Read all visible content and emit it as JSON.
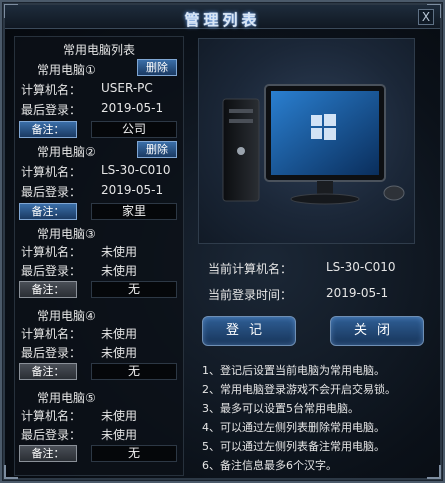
{
  "window": {
    "title": "管理列表",
    "close_label": "X"
  },
  "list": {
    "title": "常用电脑列表",
    "labels": {
      "computer_name": "计算机名：",
      "last_login": "最后登录：",
      "note_button": "备注："
    },
    "slots": [
      {
        "header": "常用电脑①",
        "delete_label": "删除",
        "computer_name": "USER-PC",
        "last_login": "2019-05-1",
        "note": "公司",
        "bound": true
      },
      {
        "header": "常用电脑②",
        "delete_label": "删除",
        "computer_name": "LS-30-C010",
        "last_login": "2019-05-1",
        "note": "家里",
        "bound": true
      },
      {
        "header": "常用电脑③",
        "computer_name": "未使用",
        "last_login": "未使用",
        "note": "无",
        "bound": false
      },
      {
        "header": "常用电脑④",
        "computer_name": "未使用",
        "last_login": "未使用",
        "note": "无",
        "bound": false
      },
      {
        "header": "常用电脑⑤",
        "computer_name": "未使用",
        "last_login": "未使用",
        "note": "无",
        "bound": false
      }
    ]
  },
  "current": {
    "name_label": "当前计算机名：",
    "name_value": "LS-30-C010",
    "time_label": "当前登录时间：",
    "time_value": "2019-05-1"
  },
  "buttons": {
    "register": "登记",
    "close": "关闭"
  },
  "tips": [
    "1、登记后设置当前电脑为常用电脑。",
    "2、常用电脑登录游戏不会开启交易锁。",
    "3、最多可以设置5台常用电脑。",
    "4、可以通过左侧列表删除常用电脑。",
    "5、可以通过左侧列表备注常用电脑。",
    "6、备注信息最多6个汉字。"
  ],
  "colors": {
    "accent": "#3a6ea8",
    "panel": "#0c1118",
    "text": "#e6e6e6"
  }
}
